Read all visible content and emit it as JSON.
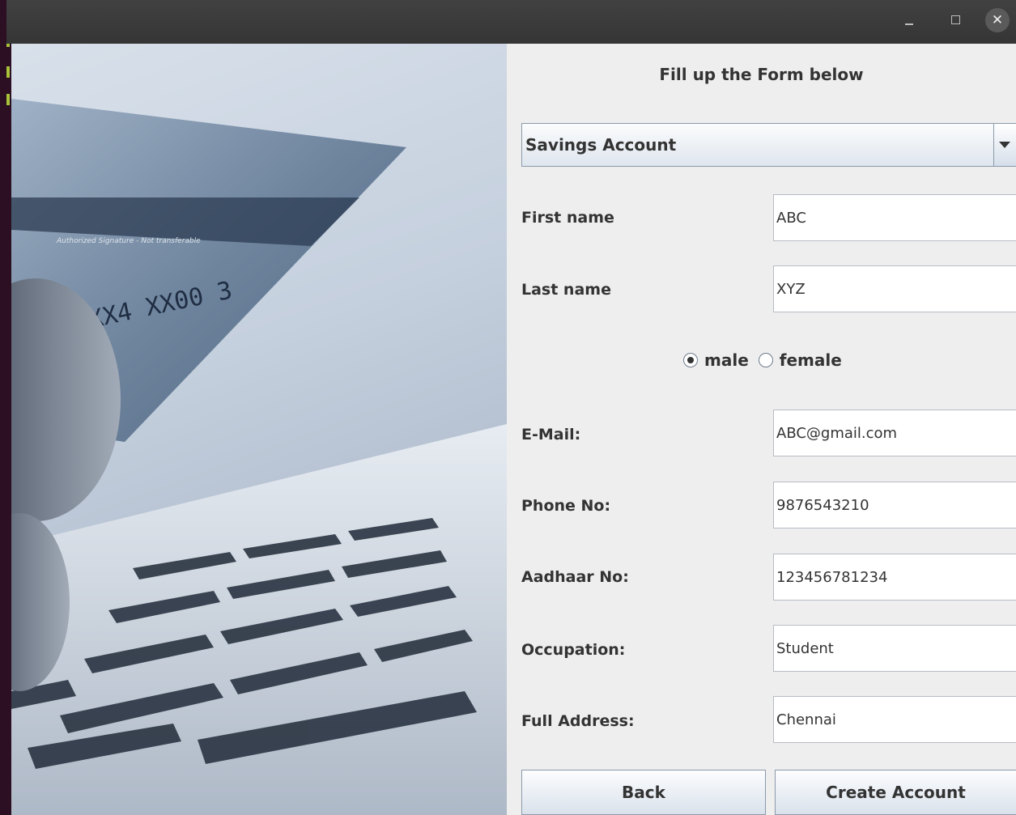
{
  "window": {
    "minimize_icon": "minimize-icon",
    "maximize_icon": "maximize-icon",
    "close_icon": "close-icon",
    "close_glyph": "✕"
  },
  "hero": {
    "description_icon": "credit-card-laptop-photo",
    "card_line_1": "Authorized Signature - Not transferable",
    "card_number_fragment": "4XX4 XX00 3"
  },
  "form": {
    "title": "Fill up the Form below",
    "account_type": {
      "selected": "Savings Account"
    },
    "fields": {
      "first_name": {
        "label": "First name",
        "value": "ABC"
      },
      "last_name": {
        "label": "Last name",
        "value": "XYZ"
      },
      "email": {
        "label": "E-Mail:",
        "value": "ABC@gmail.com"
      },
      "phone": {
        "label": "Phone No:",
        "value": "9876543210"
      },
      "aadhaar": {
        "label": "Aadhaar No:",
        "value": "123456781234"
      },
      "occupation": {
        "label": "Occupation:",
        "value": "Student"
      },
      "address": {
        "label": "Full Address:",
        "value": "Chennai"
      }
    },
    "gender": {
      "options": [
        "male",
        "female"
      ],
      "selected": "male"
    },
    "buttons": {
      "back": "Back",
      "create": "Create Account"
    }
  },
  "colors": {
    "panel_bg": "#eeeeee",
    "titlebar_bg": "#3a3a3a",
    "text": "#333333"
  }
}
